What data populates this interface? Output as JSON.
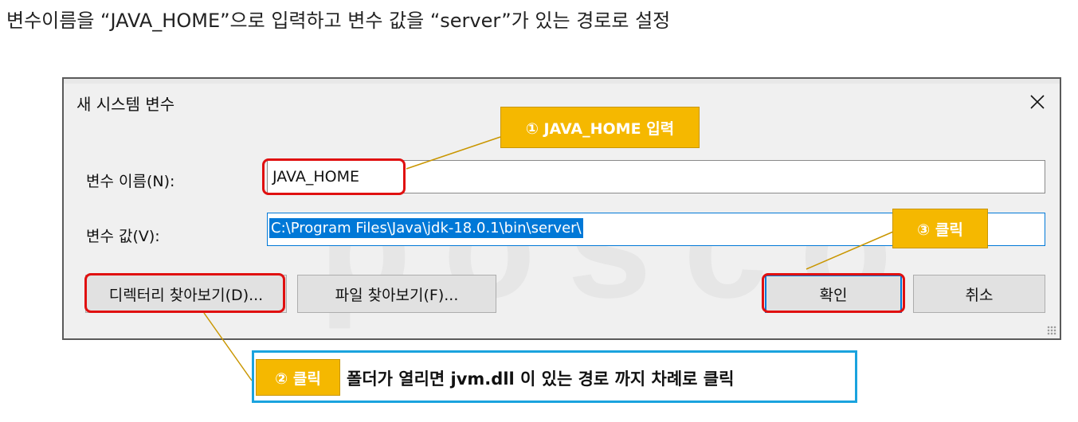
{
  "instruction": "변수이름을 “JAVA_HOME”으로 입력하고 변수 값을 “server”가 있는 경로로 설정",
  "watermark": "posco",
  "dialog": {
    "title": "새 시스템 변수",
    "close_symbol": "✕",
    "name_label": "변수 이름(N):",
    "name_value": "JAVA_HOME",
    "value_label": "변수 값(V):",
    "value_value": "C:\\Program Files\\Java\\jdk-18.0.1\\bin\\server\\",
    "browse_dir_label": "디렉터리 찾아보기(D)...",
    "browse_file_label": "파일 찾아보기(F)...",
    "ok_label": "확인",
    "cancel_label": "취소"
  },
  "callouts": {
    "step1": "① JAVA_HOME 입력",
    "step2": "② 클릭",
    "step3": "③ 클릭",
    "note": "폴더가 열리면 jvm.dll 이 있는 경로 까지 차례로 클릭"
  },
  "colors": {
    "highlight_red": "#e01010",
    "callout_gold": "#f5b800",
    "note_border": "#1aa3de",
    "selection_blue": "#0078d7"
  }
}
